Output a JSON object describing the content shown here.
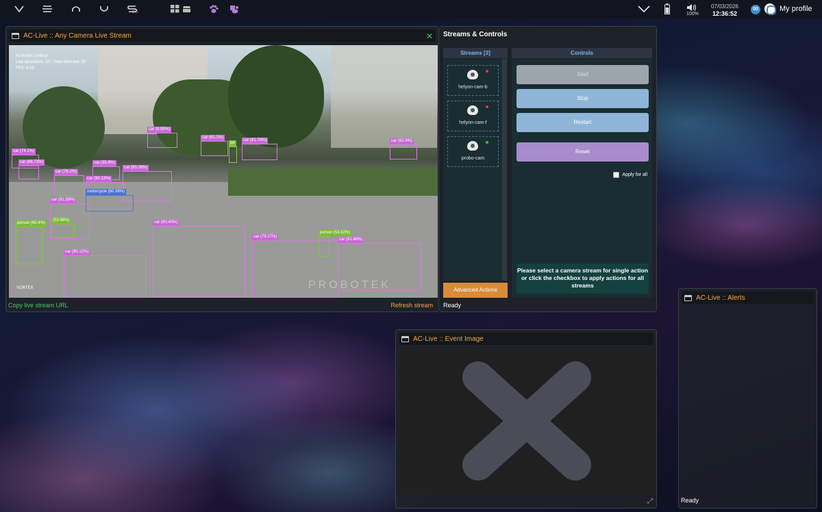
{
  "topbar": {
    "icons": [
      "v-chevron-icon",
      "menu-icon",
      "arch-icon",
      "cup-icon",
      "s-tool-icon",
      "grid-icon",
      "stack-icon",
      "paw-icon",
      "paw-app-icon"
    ],
    "s_tool_sub": "2.0",
    "volume": "100%",
    "date": "07/03/2026",
    "time": "12:36:52",
    "badge": "00",
    "profile_label": "My profile"
  },
  "live_window": {
    "title": "AC-Live :: Any Camera Live Stream",
    "overlay_lines": [
      "AI model: Unikron",
      "Live detections: 20 / Total detected: 50",
      "FPS: 8.06"
    ],
    "camera_label": "VORTEX",
    "watermark": "PROBOTEK",
    "detections": [
      {
        "label": "car (8.95%)",
        "cls": "car"
      },
      {
        "label": "car (61.1%)",
        "cls": "car"
      },
      {
        "label": "pe",
        "cls": "person"
      },
      {
        "label": "car (61.74%)",
        "cls": "car"
      },
      {
        "label": "car (62.6%)",
        "cls": "car"
      },
      {
        "label": "car (74.1%)",
        "cls": "car"
      },
      {
        "label": "car (68.73%)",
        "cls": "car"
      },
      {
        "label": "car (35.9%)",
        "cls": "car"
      },
      {
        "label": "car (76.2%)",
        "cls": "car"
      },
      {
        "label": "car (93.26%)",
        "cls": "car"
      },
      {
        "label": "car (90.13%)",
        "cls": "car"
      },
      {
        "label": "motorcycle (60.39%)",
        "cls": "moto"
      },
      {
        "label": "car (91.59%)",
        "cls": "car"
      },
      {
        "label": "person (60.4%)",
        "cls": "person"
      },
      {
        "label": "(53.96%)",
        "cls": "person"
      },
      {
        "label": "car (90.40%)",
        "cls": "car"
      },
      {
        "label": "car (79.27%)",
        "cls": "car"
      },
      {
        "label": "person (53.82%)",
        "cls": "person"
      },
      {
        "label": "car (81.88%)",
        "cls": "car"
      },
      {
        "label": "car (90.12%)",
        "cls": "car"
      }
    ],
    "copy_link": "Copy live stream URL",
    "refresh_link": "Refresh stream"
  },
  "controls_window": {
    "title": "Streams & Controls",
    "streams_header": "Streams [3]",
    "controls_header": "Controls",
    "streams": [
      {
        "name": "helyon-cam-b",
        "status_color": "#e03c3c"
      },
      {
        "name": "helyon-cam-f",
        "status_color": "#e03c3c"
      },
      {
        "name": "probo-cam",
        "status_color": "#3cb54a"
      }
    ],
    "buttons": {
      "start": "Start",
      "stop": "Stop",
      "restart": "Restart",
      "reset": "Reset"
    },
    "apply_all": "Apply for all",
    "info": "Please select a camera stream for single action or click the checkbox to apply actions for all streams",
    "advanced": "Advanced Actions",
    "status": "Ready"
  },
  "event_window": {
    "title": "AC-Live :: Event Image"
  },
  "alerts_window": {
    "title": "AC-Live :: Alerts",
    "status": "Ready"
  }
}
